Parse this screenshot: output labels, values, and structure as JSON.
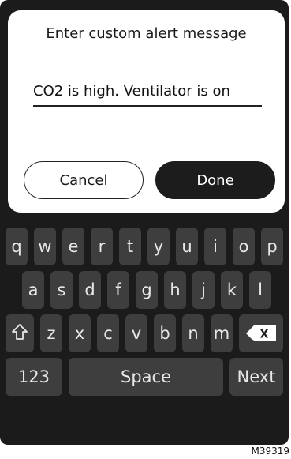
{
  "dialog": {
    "title": "Enter custom alert message",
    "message_value": "CO2 is high. Ventilator is on",
    "cancel_label": "Cancel",
    "done_label": "Done"
  },
  "keyboard": {
    "row1": [
      "q",
      "w",
      "e",
      "r",
      "t",
      "y",
      "u",
      "i",
      "o",
      "p"
    ],
    "row2": [
      "a",
      "s",
      "d",
      "f",
      "g",
      "h",
      "j",
      "k",
      "l"
    ],
    "row3": [
      "z",
      "x",
      "c",
      "v",
      "b",
      "n",
      "m"
    ],
    "numbers_label": "123",
    "space_label": "Space",
    "next_label": "Next",
    "shift_icon": "shift-arrow-icon",
    "delete_icon": "backspace-icon",
    "delete_glyph": "X"
  },
  "figure_id": "M39319"
}
